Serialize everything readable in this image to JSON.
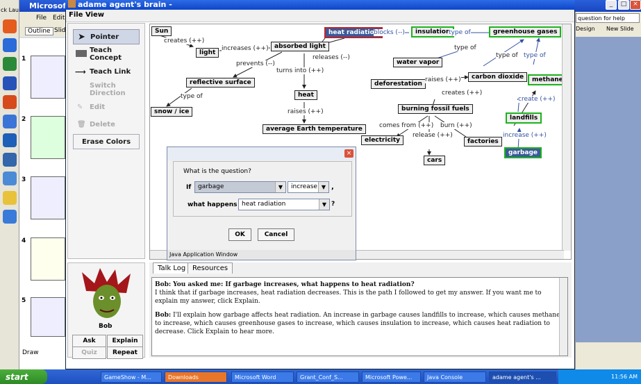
{
  "desktop": {
    "left_label": "ck Lau"
  },
  "powerpoint": {
    "title": "Microsoft P",
    "menu": [
      "File",
      "Edit"
    ],
    "tabs": [
      "Outline",
      "Slid"
    ],
    "help_box": "question for help",
    "toolbar_items": [
      "Design",
      "New Slide"
    ],
    "slide_numbers": [
      "1",
      "2",
      "3",
      "4",
      "5"
    ],
    "draw_label": "Draw"
  },
  "java": {
    "title": "adame agent's brain -",
    "menu": [
      "File",
      "View"
    ],
    "tools": [
      {
        "label": "Pointer",
        "state": "active"
      },
      {
        "label": "Teach Concept",
        "state": "normal"
      },
      {
        "label": "Teach Link",
        "state": "normal"
      },
      {
        "label": "Switch Direction",
        "state": "disabled"
      },
      {
        "label": "Edit",
        "state": "disabled"
      },
      {
        "label": "Delete",
        "state": "disabled"
      },
      {
        "label": "Erase Colors",
        "state": "normal"
      }
    ],
    "map": {
      "nodes": {
        "sun": "Sun",
        "light": "light",
        "absorbed_light": "absorbed light",
        "heat_radiation": "heat radiation",
        "insulation": "insulation",
        "greenhouse_gases": "greenhouse gases",
        "water_vapor": "water vapor",
        "reflective_surface": "reflective surface",
        "heat": "heat",
        "deforestation": "deforestation",
        "carbon_dioxide": "carbon dioxide",
        "methane": "methane",
        "snow_ice": "snow / ice",
        "average_earth_temperature": "average Earth temperature",
        "burning_fossil_fuels": "burning fossil fuels",
        "landfills": "landfills",
        "electricity": "electricity",
        "factories": "factories",
        "cars": "cars",
        "garbage": "garbage"
      },
      "links": {
        "creates": "creates (++)",
        "increases": "increases (++)",
        "prevents": "prevents (--)",
        "releases": "releases (--)",
        "turns_into": "turns into (++)",
        "blocks": "blocks (--)",
        "type_of_1": "type of",
        "type_of_2": "type of",
        "type_of_3": "type of",
        "type_of_4": "type of",
        "type_of_5": "type of",
        "raises1": "raises (++)",
        "raises2": "raises (++)",
        "creates2": "creates (++)",
        "create3": "create (++)",
        "comes_from": "comes from (++)",
        "release": "release (++)",
        "burn": "burn (++)",
        "increase": "increase (++)"
      }
    },
    "dialog": {
      "group_label": "What is the question?",
      "if_label": "If",
      "if_value": "garbage",
      "change_value": "increase",
      "comma": ",",
      "what_label": "what happens to",
      "target_value": "heat radiation",
      "qmark": "?",
      "ok": "OK",
      "cancel": "Cancel",
      "footer": "Java Application Window"
    },
    "agent": {
      "name": "Bob",
      "buttons": [
        "Ask",
        "Explain",
        "Quiz",
        "Repeat"
      ]
    },
    "tabs": [
      "Talk Log",
      "Resources"
    ],
    "talk": {
      "q_speaker": "Bob:",
      "q_text": "You asked me: If garbage increases, what happens to heat radiation?",
      "answer": "I think that if garbage increases, heat radiation decreases. This is the path I followed to get my answer. If you want me to explain my answer, click Explain.",
      "e_speaker": "Bob:",
      "explanation": "I'll explain how garbage affects heat radiation. An increase in garbage causes landfills to increase, which causes methane to increase, which causes greenhouse gases to increase, which causes insulation to increase, which causes heat radiation to decrease. Click Explain to hear more."
    }
  },
  "taskbar": {
    "start": "start",
    "tasks": [
      "GameShow - M...",
      "Downloads",
      "Microsoft Word",
      "Grant_Conf_S...",
      "Microsoft Powe...",
      "Java Console",
      "adame agent's ..."
    ],
    "clock": "11:56 AM"
  }
}
